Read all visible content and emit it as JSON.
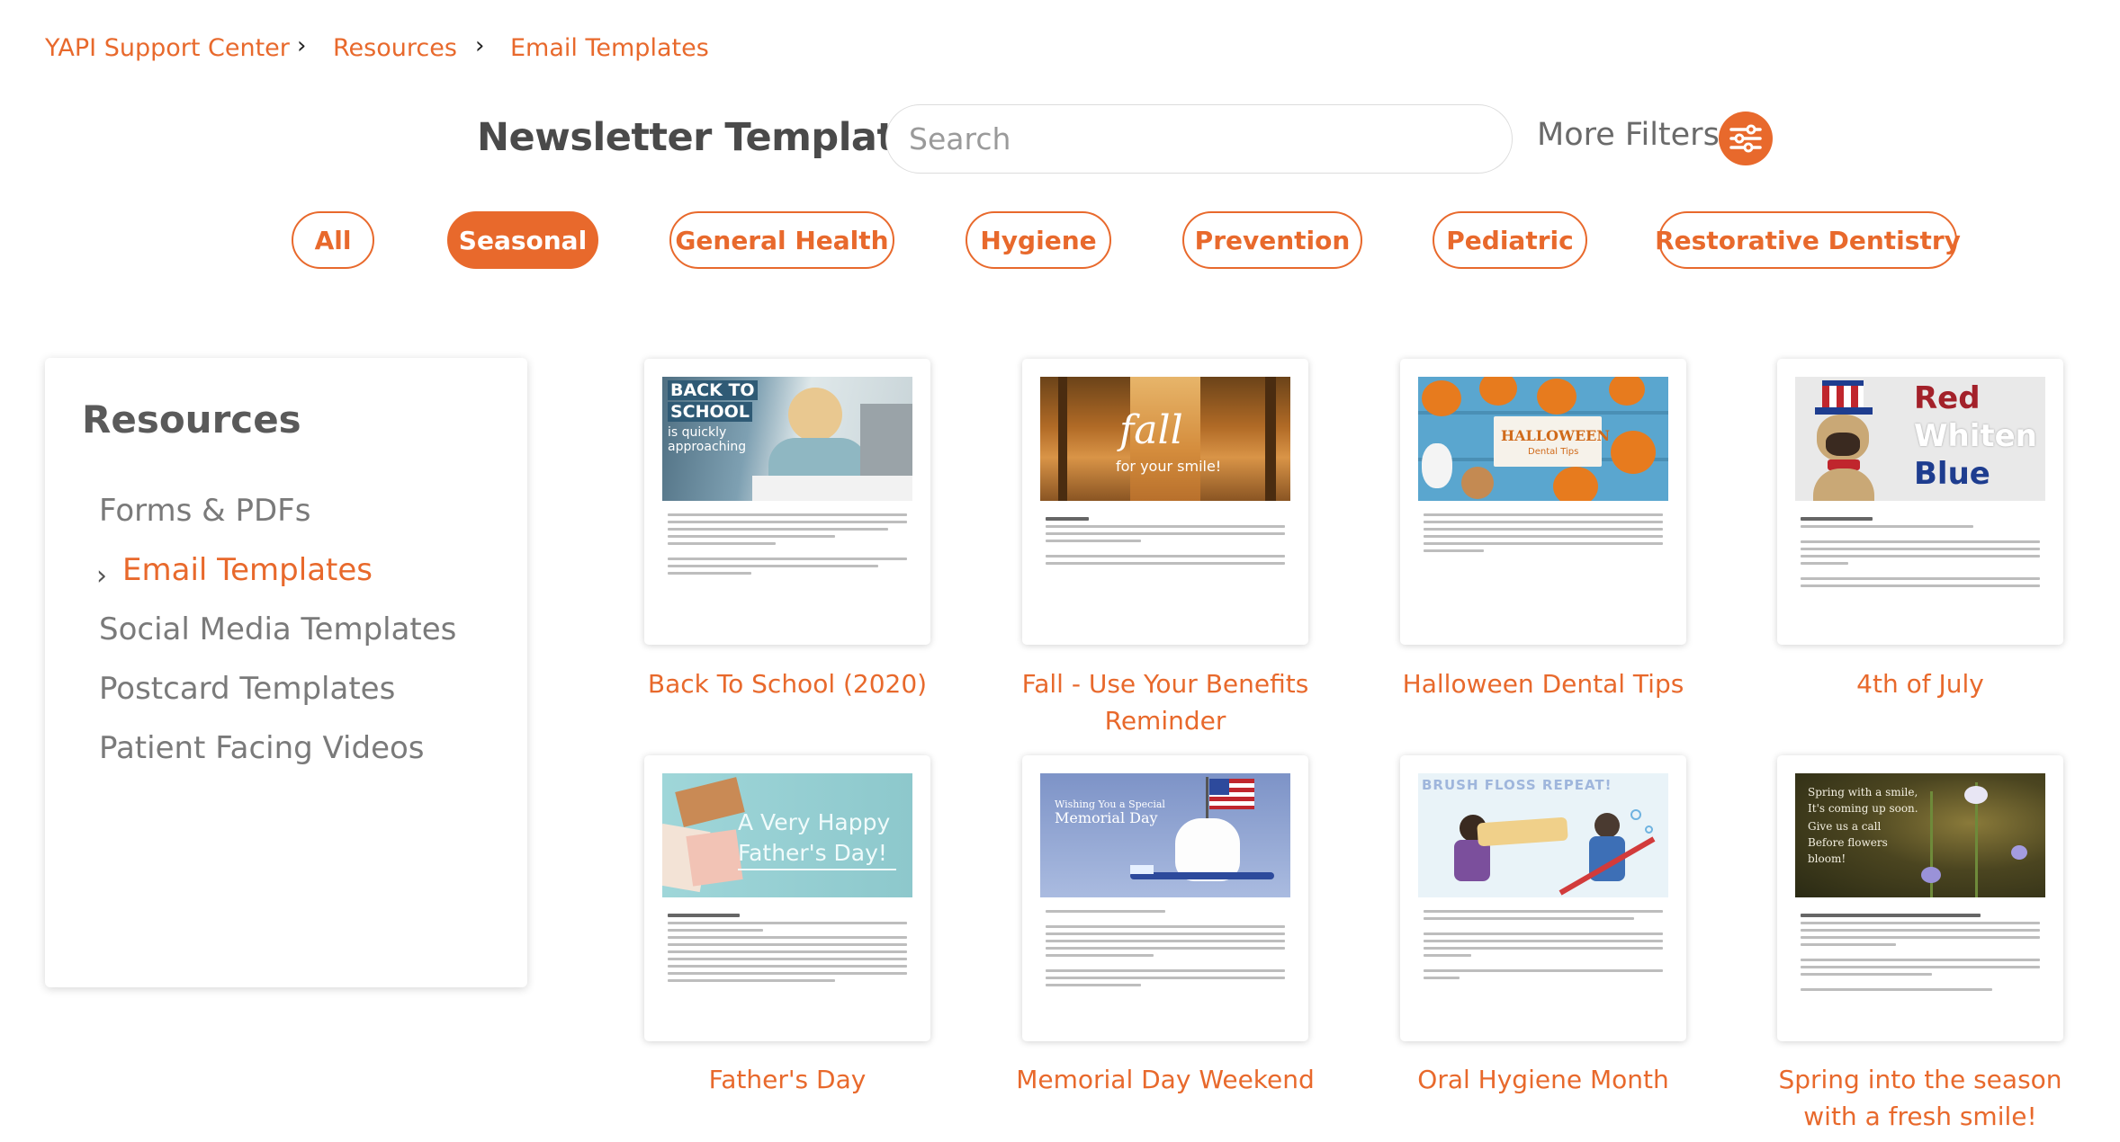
{
  "breadcrumb": {
    "root": "YAPI Support Center",
    "level1": "Resources",
    "level2": "Email Templates"
  },
  "header": {
    "title": "Newsletter Templates",
    "search_placeholder": "Search",
    "more_filters": "More Filters"
  },
  "filters": [
    "All",
    "Seasonal",
    "General Health",
    "Hygiene",
    "Prevention",
    "Pediatric",
    "Restorative Dentistry"
  ],
  "active_filter": "Seasonal",
  "sidebar": {
    "title": "Resources",
    "items": [
      "Forms & PDFs",
      "Email Templates",
      "Social Media Templates",
      "Postcard Templates",
      "Patient Facing Videos"
    ],
    "active": "Email Templates"
  },
  "templates": [
    {
      "caption_line1": "Back To School (2020)",
      "caption_line2": "",
      "thumb_text": [
        "BACK TO",
        "SCHOOL",
        "is quickly",
        "approaching"
      ]
    },
    {
      "caption_line1": "Fall - Use Your Benefits",
      "caption_line2": "Reminder",
      "thumb_text": [
        "fall",
        "for your smile!"
      ]
    },
    {
      "caption_line1": "Halloween Dental Tips",
      "caption_line2": "",
      "thumb_text": [
        "HALLOWEEN",
        "Dental Tips"
      ]
    },
    {
      "caption_line1": "4th of July",
      "caption_line2": "",
      "thumb_text": [
        "Red",
        "Whiten",
        "Blue"
      ]
    },
    {
      "caption_line1": "Father's Day",
      "caption_line2": "",
      "thumb_text": [
        "A Very Happy",
        "Father's Day!"
      ]
    },
    {
      "caption_line1": "Memorial Day Weekend",
      "caption_line2": "",
      "thumb_text": [
        "Wishing You a Special",
        "Memorial Day"
      ]
    },
    {
      "caption_line1": "Oral Hygiene Month",
      "caption_line2": "",
      "thumb_text": [
        "BRUSH FLOSS REPEAT!"
      ]
    },
    {
      "caption_line1": "Spring into the season",
      "caption_line2": "with a fresh smile!",
      "thumb_text": [
        "Spring with a smile,",
        "It's coming up soon.",
        "Give us a call",
        "Before flowers",
        "bloom!"
      ]
    }
  ],
  "colors": {
    "accent": "#e8692c",
    "text": "#555555"
  },
  "icons": {
    "breadcrumb_separator": "chevron-right-icon",
    "filter": "sliders-icon",
    "sidebar_active": "chevron-right-icon"
  }
}
